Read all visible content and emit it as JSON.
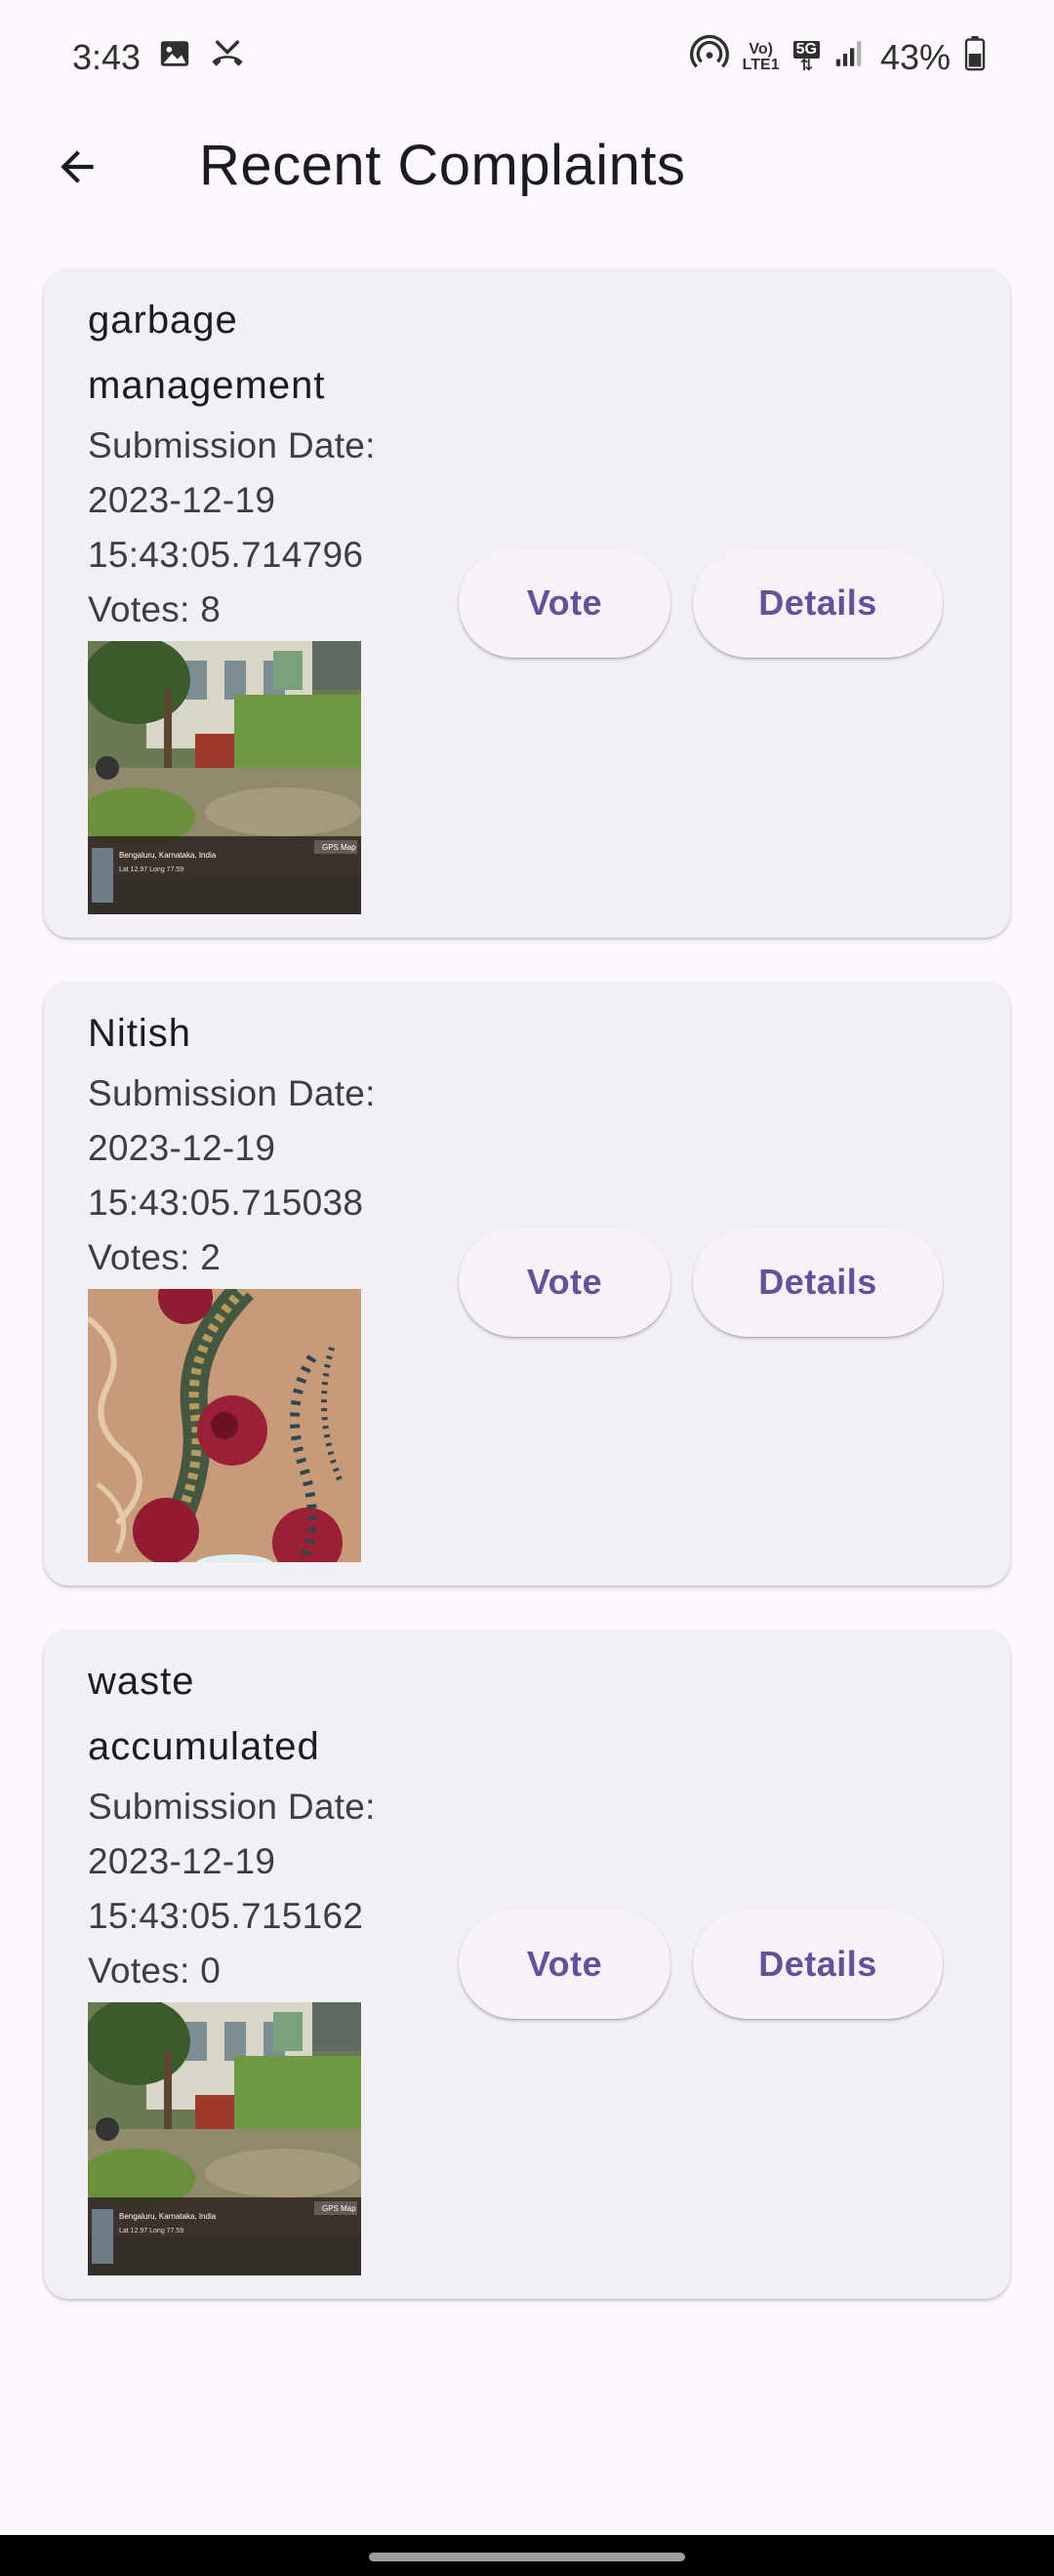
{
  "status_bar": {
    "time": "3:43",
    "battery": "43%",
    "network_label_top": "Vo)",
    "network_label_bottom": "LTE1",
    "net_type": "5G"
  },
  "app_bar": {
    "title": "Recent Complaints"
  },
  "complaints": [
    {
      "title_line1": "garbage",
      "title_line2": "management",
      "date_label": "Submission Date:",
      "date": "2023-12-19",
      "time": "15:43:05.714796",
      "votes": "Votes: 8",
      "vote_label": "Vote",
      "details_label": "Details",
      "photo_caption_line1": "Bengaluru, Karnataka, India",
      "photo_caption_line2": "Lat 12.97 Long 77.59",
      "photo_brand": "GPS Map"
    },
    {
      "title_line1": "Nitish",
      "date_label": "Submission Date:",
      "date": "2023-12-19",
      "time": "15:43:05.715038",
      "votes": "Votes: 2",
      "vote_label": "Vote",
      "details_label": "Details"
    },
    {
      "title_line1": "waste",
      "title_line2": "accumulated",
      "date_label": "Submission Date:",
      "date": "2023-12-19",
      "time": "15:43:05.715162",
      "votes": "Votes: 0",
      "vote_label": "Vote",
      "details_label": "Details",
      "photo_caption_line1": "Bengaluru, Karnataka, India",
      "photo_caption_line2": "Lat 12.97 Long 77.59",
      "photo_brand": "GPS Map"
    }
  ],
  "colors": {
    "background": "#fdf8fd",
    "card": "#f3eff6",
    "button_text": "#63519a"
  }
}
